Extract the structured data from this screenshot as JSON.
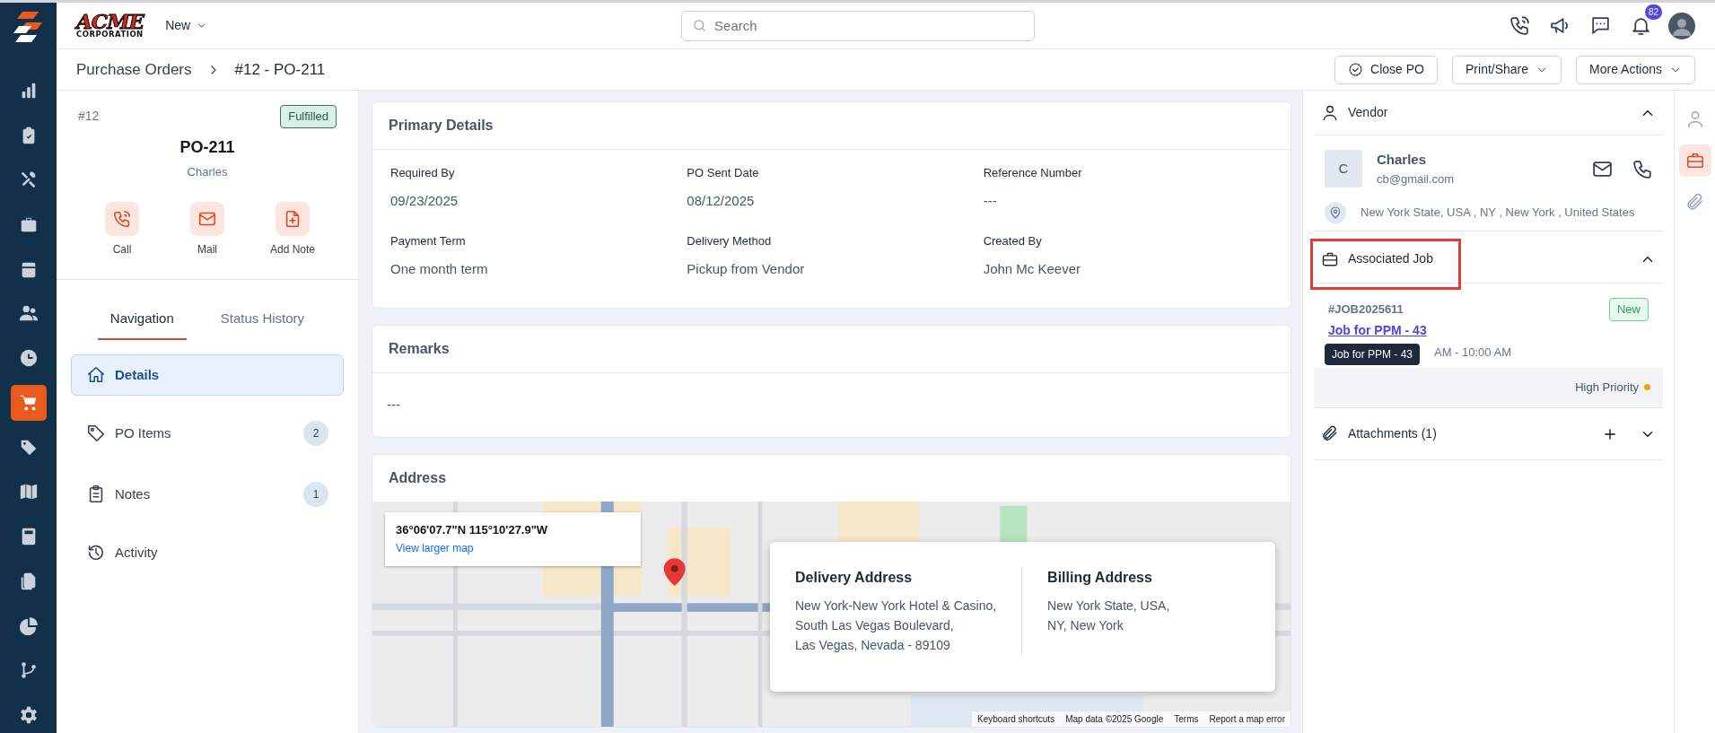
{
  "sidebar": {
    "items": [
      {
        "kind": "chart",
        "selected": false
      },
      {
        "kind": "clipboard",
        "selected": false
      },
      {
        "kind": "tools",
        "selected": false
      },
      {
        "kind": "briefcase",
        "selected": false
      },
      {
        "kind": "calendar",
        "selected": false
      },
      {
        "kind": "users",
        "selected": false
      },
      {
        "kind": "clock",
        "selected": false
      },
      {
        "kind": "cart",
        "selected": true
      },
      {
        "kind": "tag",
        "selected": false
      },
      {
        "kind": "map",
        "selected": false
      },
      {
        "kind": "calculator",
        "selected": false
      },
      {
        "kind": "files",
        "selected": false
      },
      {
        "kind": "pie",
        "selected": false
      },
      {
        "kind": "branch",
        "selected": false
      },
      {
        "kind": "gear",
        "selected": false
      }
    ]
  },
  "topbar": {
    "logo": {
      "name": "ACME",
      "subtitle": "CORPORATION"
    },
    "new_menu": "New",
    "search": {
      "placeholder": "Search"
    },
    "notification_count": "82"
  },
  "breadcrumb": [
    "Purchase Orders",
    "#12 - PO-211"
  ],
  "actions": [
    {
      "label": "Close PO",
      "kind": "status"
    },
    {
      "label": "Print/Share",
      "kind": "dropdown"
    },
    {
      "label": "More Actions",
      "kind": "dropdown"
    }
  ],
  "summary": {
    "number": "#12",
    "status": "Fulfilled",
    "title": "PO-211",
    "vendor": "Charles",
    "quick_actions": [
      {
        "kind": "call",
        "label": "Call"
      },
      {
        "kind": "mail",
        "label": "Mail"
      },
      {
        "kind": "note",
        "label": "Add Note"
      }
    ]
  },
  "tabs": [
    {
      "label": "Navigation",
      "selected": true
    },
    {
      "label": "Status History",
      "selected": false
    }
  ],
  "nav": [
    {
      "kind": "home",
      "label": "Details",
      "selected": true
    },
    {
      "kind": "tag",
      "label": "PO Items",
      "count": "2",
      "selected": false
    },
    {
      "kind": "notes",
      "label": "Notes",
      "count": "1",
      "selected": false
    },
    {
      "kind": "history",
      "label": "Activity",
      "selected": false
    }
  ],
  "primary_details": {
    "title": "Primary Details",
    "fields": [
      {
        "label": "Required By",
        "value": "09/23/2025"
      },
      {
        "label": "PO Sent Date",
        "value": "08/12/2025"
      },
      {
        "label": "Reference Number",
        "value": "---"
      },
      {
        "label": "Payment Term",
        "value": "One month term"
      },
      {
        "label": "Delivery Method",
        "value": "Pickup from Vendor"
      },
      {
        "label": "Created By",
        "value": "John Mc Keever"
      }
    ]
  },
  "remarks": {
    "title": "Remarks",
    "text": "---"
  },
  "address": {
    "title": "Address",
    "map": {
      "kind": "picture",
      "coordinates": "36°06'07.7\"N 115°10'27.9\"W",
      "larger_map_link": "View larger map",
      "footer": [
        "Keyboard shortcuts",
        "Map data ©2025 Google",
        "Terms",
        "Report a map error"
      ]
    },
    "columns": [
      {
        "title": "Delivery Address",
        "lines": [
          "New York-New York Hotel & Casino,",
          "South Las Vegas Boulevard,",
          "Las Vegas, Nevada - 89109"
        ]
      },
      {
        "title": "Billing Address",
        "lines": [
          "New York State, USA,",
          "NY, New York"
        ]
      }
    ]
  },
  "vendor": {
    "title": "Vendor",
    "expanded": true,
    "initial": "C",
    "name": "Charles",
    "email": "cb@gmail.com",
    "location": "New York State, USA , NY , New York , United States"
  },
  "associated_job": {
    "title": "Associated Job",
    "expanded": true,
    "highlighted": true,
    "job_id": "#JOB2025611",
    "status": "New",
    "link": "Job for PPM - 43",
    "time": "AM - 10:00 AM",
    "tooltip": "Job for PPM - 43",
    "priority": {
      "label": "High Priority",
      "color": "#f59e0b"
    }
  },
  "attachments": {
    "title": "Attachments (1)",
    "expanded": false
  },
  "right_rail": [
    {
      "kind": "person",
      "selected": false
    },
    {
      "kind": "briefcase",
      "selected": true
    },
    {
      "kind": "paperclip",
      "selected": false
    }
  ]
}
